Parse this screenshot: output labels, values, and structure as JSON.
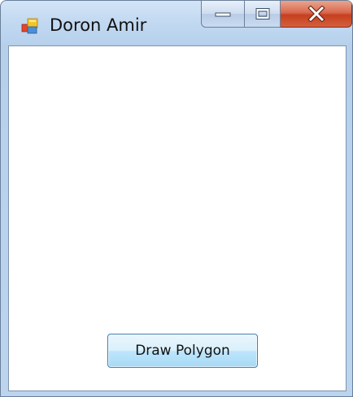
{
  "window": {
    "title": "Doron Amir",
    "icon": "windows-forms-app-icon"
  },
  "caption_buttons": {
    "minimize_icon": "minimize-icon",
    "maximize_icon": "maximize-icon",
    "close_icon": "close-icon"
  },
  "main": {
    "draw_button_label": "Draw Polygon"
  },
  "colors": {
    "close_button": "#c6401f",
    "button_border": "#3c7fb1",
    "titlebar": "#c1d8f1"
  }
}
